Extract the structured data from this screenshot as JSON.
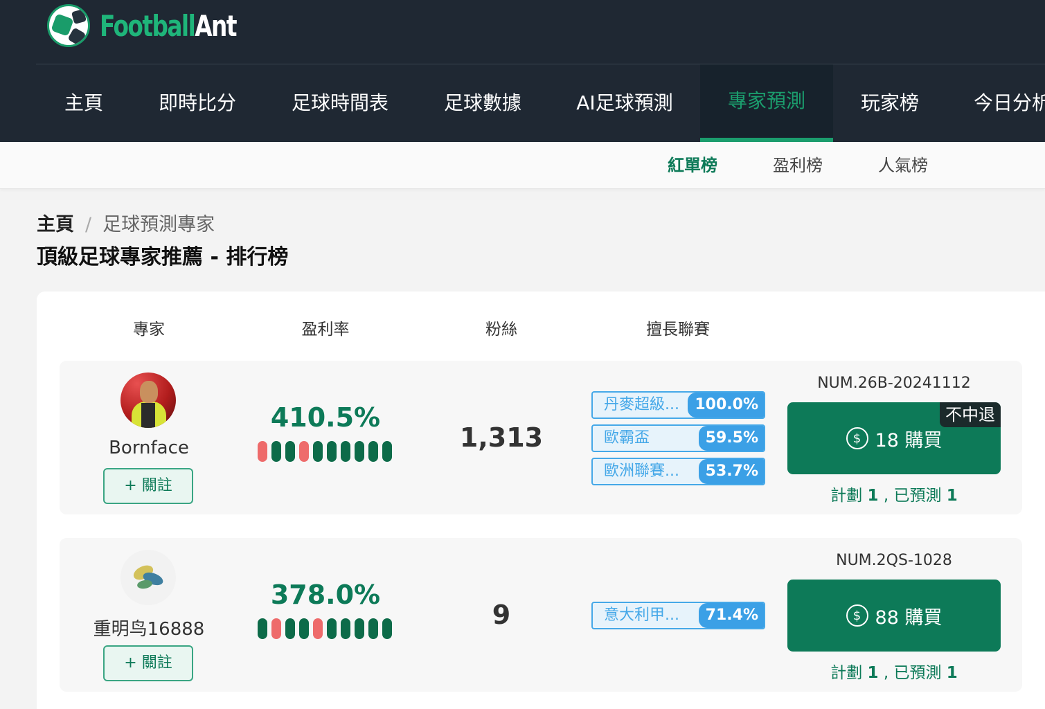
{
  "brand": {
    "part1": "Football",
    "part2": "Ant",
    "accent": "#1fb57a"
  },
  "nav": [
    {
      "label": "主頁",
      "active": false
    },
    {
      "label": "即時比分",
      "active": false
    },
    {
      "label": "足球時間表",
      "active": false
    },
    {
      "label": "足球數據",
      "active": false
    },
    {
      "label": "AI足球預測",
      "active": false
    },
    {
      "label": "專家預測",
      "active": true
    },
    {
      "label": "玩家榜",
      "active": false
    },
    {
      "label": "今日分析",
      "active": false
    }
  ],
  "subnav": [
    {
      "label": "紅單榜",
      "active": true
    },
    {
      "label": "盈利榜",
      "active": false
    },
    {
      "label": "人氣榜",
      "active": false
    }
  ],
  "breadcrumb": {
    "home": "主頁",
    "separator": "/",
    "current": "足球預測專家"
  },
  "page_title": "頂級足球專家推薦 - 排行榜",
  "table": {
    "headers": [
      "專家",
      "盈利率",
      "粉絲",
      "擅長聯賽"
    ],
    "rows": [
      {
        "name": "Bornface",
        "follow_label": "+ 關註",
        "rate": "410.5%",
        "streak": [
          "red",
          "green",
          "green",
          "red",
          "green",
          "green",
          "green",
          "green",
          "green",
          "green"
        ],
        "fans": "1,313",
        "leagues": [
          {
            "name": "丹麥超級...",
            "pct": "100.0%"
          },
          {
            "name": "歐霸盃",
            "pct": "59.5%"
          },
          {
            "name": "歐洲聯賽...",
            "pct": "53.7%"
          }
        ],
        "plan_code": "NUM.26B-20241112",
        "price": "18 購買",
        "badge": "不中退",
        "plan_label": "計劃",
        "plan_count": "1",
        "predicted_label": ", 已預測",
        "predicted_count": "1"
      },
      {
        "name": "重明鸟16888",
        "follow_label": "+ 關註",
        "rate": "378.0%",
        "streak": [
          "green",
          "red",
          "green",
          "green",
          "red",
          "green",
          "green",
          "green",
          "green",
          "green"
        ],
        "fans": "9",
        "leagues": [
          {
            "name": "意大利甲...",
            "pct": "71.4%"
          }
        ],
        "plan_code": "NUM.2QS-1028",
        "price": "88 購買",
        "badge": "",
        "plan_label": "計劃",
        "plan_count": "1",
        "predicted_label": ", 已預測",
        "predicted_count": "1"
      }
    ]
  },
  "colors": {
    "primary": "#0d7a58",
    "streak_red": "#ee6b6b",
    "streak_green": "#0d6b49",
    "league_blue": "#3ba0e6"
  },
  "icons": {
    "coin": "dollar-coin-icon",
    "logo": "soccer-ball-icon"
  }
}
